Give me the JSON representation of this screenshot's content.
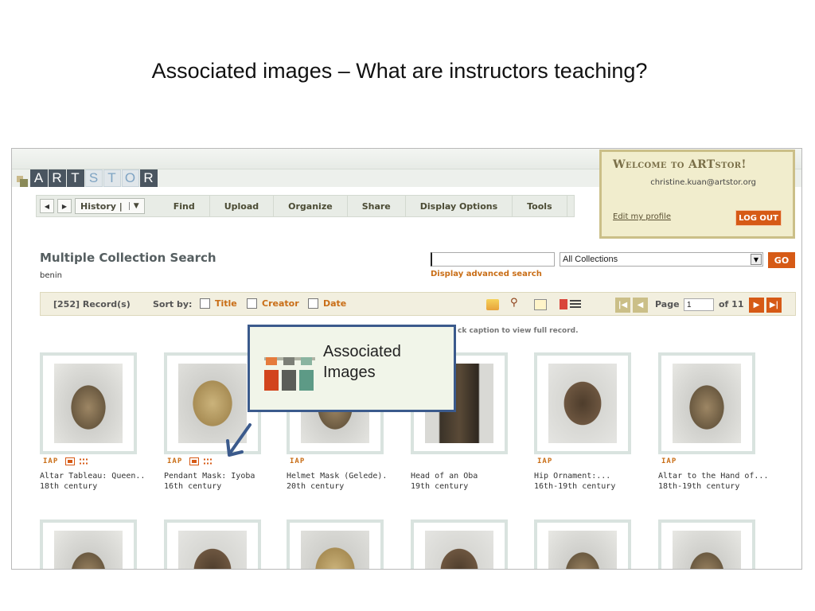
{
  "slide": {
    "title": "Associated images – What are instructors teaching?"
  },
  "logo": {
    "letters": [
      "A",
      "R",
      "T",
      "S",
      "T",
      "O",
      "R"
    ]
  },
  "nav": {
    "history_label": "History |",
    "items": [
      "Find",
      "Upload",
      "Organize",
      "Share",
      "Display Options",
      "Tools"
    ]
  },
  "welcome": {
    "title": "Welcome to ARTstor!",
    "email": "christine.kuan@artstor.org",
    "edit_profile": "Edit my profile",
    "logout": "LOG OUT"
  },
  "search": {
    "title": "Multiple Collection Search",
    "term": "benin",
    "input_value": "",
    "advanced": "Display advanced search",
    "collection": "All Collections",
    "go": "GO"
  },
  "results": {
    "records": "[252] Record(s)",
    "sort_by": "Sort by:",
    "sort_options": [
      "Title",
      "Creator",
      "Date"
    ],
    "page_label": "Page",
    "page_value": "1",
    "of_label": "of 11",
    "hint": "ck caption to view full record."
  },
  "thumbnails": [
    {
      "badge": "IAP",
      "title": "Altar Tableau: Queen..",
      "date": "18th century"
    },
    {
      "badge": "IAP",
      "title": "Pendant Mask: Iyoba",
      "date": "16th century"
    },
    {
      "badge": "IAP",
      "title": "Helmet Mask (Gelede).",
      "date": "20th century"
    },
    {
      "badge": "",
      "title": "Head of an Oba",
      "date": "19th century"
    },
    {
      "badge": "IAP",
      "title": "Hip Ornament:...",
      "date": "16th-19th century"
    },
    {
      "badge": "IAP",
      "title": "Altar to the Hand of...",
      "date": "18th-19th century"
    }
  ],
  "callout": {
    "line1": "Associated",
    "line2": "Images"
  },
  "colors": {
    "accent_orange": "#d65a16",
    "welcome_bg": "#f1edcd",
    "callout_border": "#3b5a8c",
    "link_orange": "#c96e17"
  }
}
